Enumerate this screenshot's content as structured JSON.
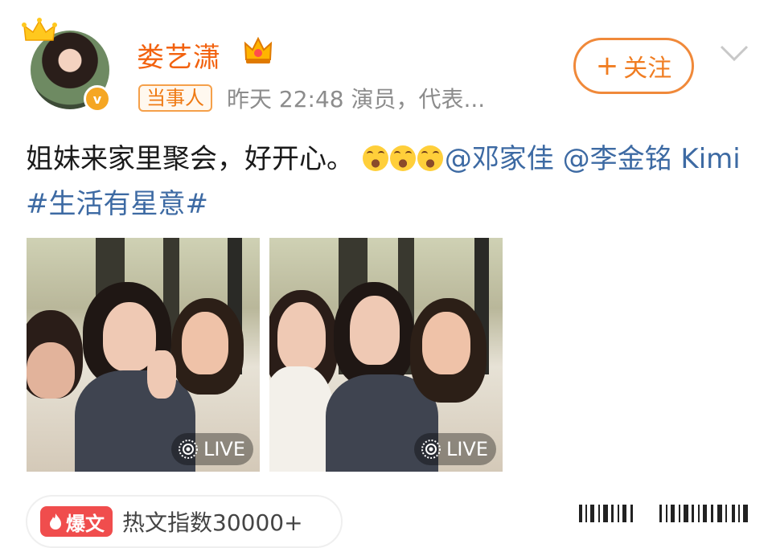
{
  "user": {
    "name": "娄艺潇",
    "tag": "当事人",
    "meta": "昨天 22:48   演员，代表...",
    "verify_mark": "v"
  },
  "follow_button": {
    "plus": "+",
    "label": "关注"
  },
  "post": {
    "text": "姐妹来家里聚会，好开心。",
    "mention_1": "@邓家佳",
    "mention_2": "@李金铭 Kimi",
    "hashtag": "#生活有星意#"
  },
  "photos": [
    {
      "live_label": "LIVE"
    },
    {
      "live_label": "LIVE"
    }
  ],
  "hot": {
    "tag": "爆文",
    "text": "热文指数30000+"
  },
  "colors": {
    "orange": "#f2620f",
    "link": "#3d6aa3",
    "hot_red": "#f04d4d"
  }
}
